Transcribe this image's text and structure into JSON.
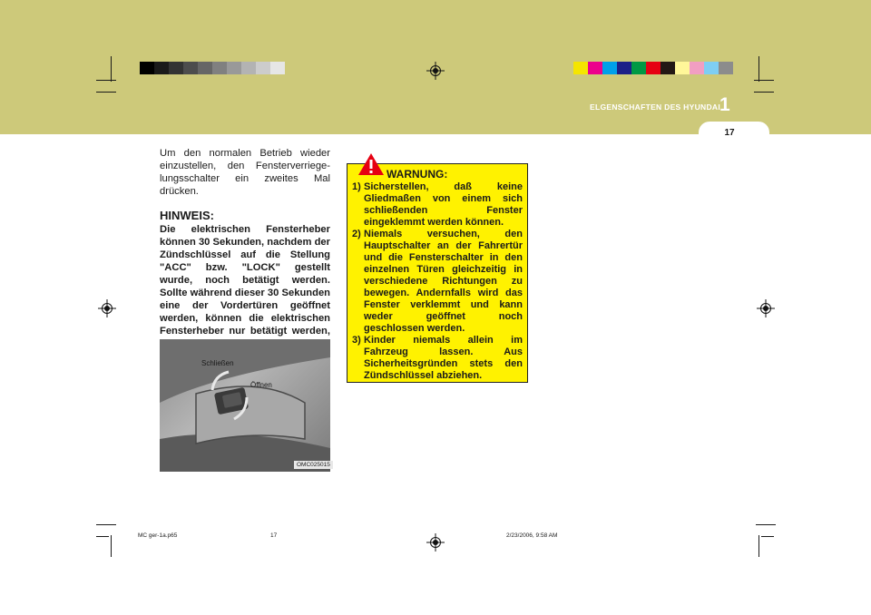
{
  "header": {
    "section_title": "ELGENSCHAFTEN DES HYUNDAI",
    "section_number": "1",
    "page_number": "17",
    "band_color": "#cdc97a",
    "gray_swatches": [
      "#000000",
      "#1a1a1a",
      "#333333",
      "#4d4d4d",
      "#666666",
      "#808080",
      "#999999",
      "#b3b3b3",
      "#cccccc",
      "#e6e6e6"
    ],
    "color_swatches": [
      "#f5e500",
      "#ec008c",
      "#00a0e9",
      "#1d2088",
      "#009944",
      "#e60012",
      "#231815",
      "#fff799",
      "#f19ec2",
      "#7ecef4",
      "#8c8c8c"
    ]
  },
  "body": {
    "intro": "Um den normalen Betrieb wieder einzustellen, den Fensterverriege-lungsschalter ein zweites Mal drücken.",
    "hinweis_title": "HINWEIS:",
    "hinweis_text": "Die elektrischen Fensterheber können 30 Sekunden, nachdem der Zündschlüssel auf die Stellung \"ACC\" bzw. \"LOCK\" gestellt wurde, noch betätigt werden. Sollte während dieser 30 Sekunden eine der Vordertüren geöffnet werden, können die elektrischen Fensterheber nur betätigt werden, wenn sich der Zündschlüssel in Position \"ON\" befindet."
  },
  "figure": {
    "label_close": "Schließen",
    "label_open": "Öffnen",
    "code": "OMC025015"
  },
  "warning": {
    "icon_name": "warning-exclamation-icon",
    "title": "WARNUNG:",
    "items": [
      {
        "num": "1)",
        "text": "Sicherstellen, daß keine Gliedmaßen von einem sich schließenden Fenster eingeklemmt werden können."
      },
      {
        "num": "2)",
        "text": "Niemals versuchen, den Hauptschalter an der Fahrertür und die Fensterschalter in den einzelnen Türen gleichzeitig in verschiedene Richtungen zu bewegen. Andernfalls wird das Fenster verklemmt und kann weder geöffnet noch geschlossen werden."
      },
      {
        "num": "3)",
        "text": "Kinder niemals allein im Fahrzeug lassen. Aus Sicherheitsgründen stets den Zündschlüssel abziehen."
      }
    ],
    "bg_color": "#fff200"
  },
  "slug": {
    "file": "MC ger-1a.p65",
    "page": "17",
    "date": "2/23/2006, 9:58 AM"
  }
}
